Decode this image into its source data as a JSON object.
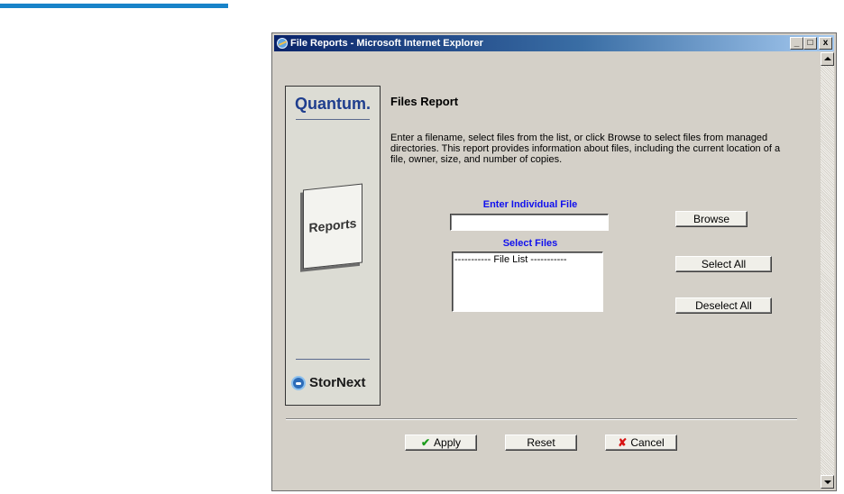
{
  "window": {
    "title": "File Reports - Microsoft Internet Explorer",
    "minimize": "_",
    "maximize": "□",
    "close": "x"
  },
  "brand": {
    "logo": "Quantum.",
    "book_label": "Reports",
    "footer_logo": "StorNext",
    "accent_color": "#1883c9"
  },
  "report": {
    "title": "Files Report",
    "description": "Enter a filename, select files from the list, or click Browse to select files from managed directories. This report provides information about files, including the current location of a file, owner, size, and number of copies."
  },
  "form": {
    "individual_label": "Enter Individual File",
    "individual_value": "",
    "select_label": "Select Files",
    "file_list_items": [
      "----------- File List -----------"
    ],
    "browse_label": "Browse",
    "select_all_label": "Select All",
    "deselect_all_label": "Deselect All"
  },
  "actions": {
    "apply_label": "Apply",
    "reset_label": "Reset",
    "cancel_label": "Cancel"
  }
}
